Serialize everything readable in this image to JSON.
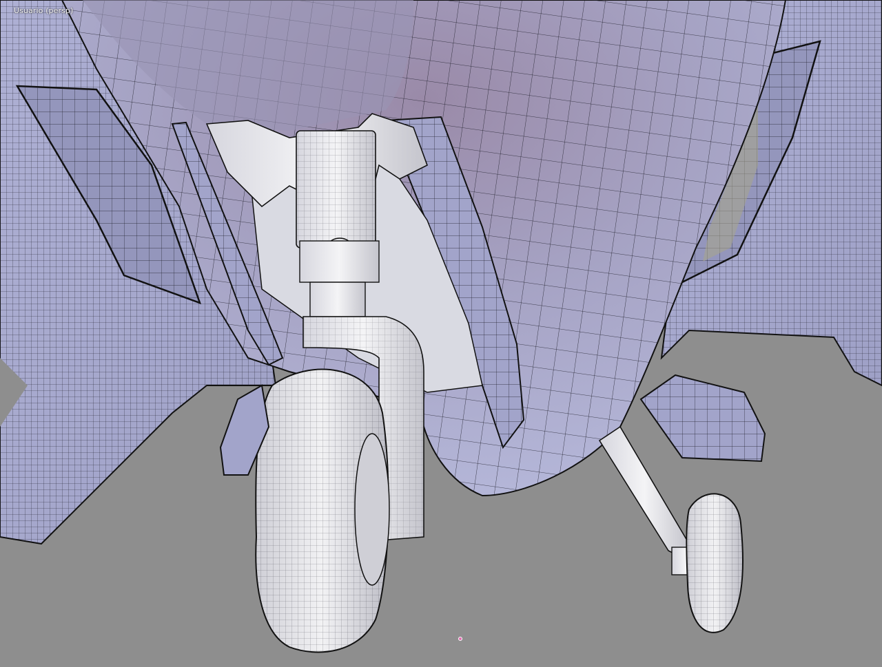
{
  "viewport": {
    "label": "Usuario (persp)",
    "background": "#8e8e8e",
    "mesh_color": "#a6a8cc",
    "wire_color": "#1a1a1a",
    "origin_marker_color": "#e070b0"
  }
}
